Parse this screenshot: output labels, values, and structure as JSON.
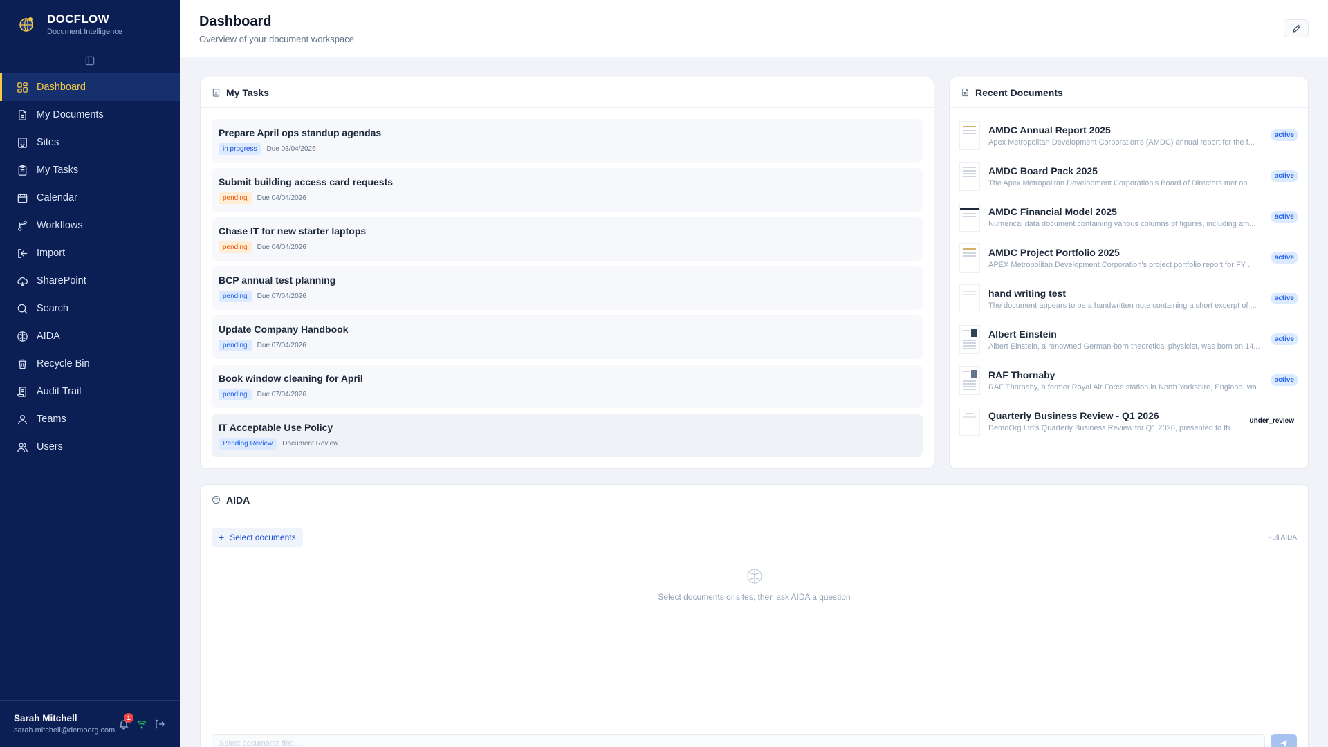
{
  "brand": {
    "name": "DOCFLOW",
    "subtitle": "Document Intelligence",
    "icon": "globe-logo-icon"
  },
  "sidebar": {
    "items": [
      {
        "label": "Dashboard",
        "icon": "grid-icon",
        "active": true
      },
      {
        "label": "My Documents",
        "icon": "document-icon"
      },
      {
        "label": "Sites",
        "icon": "building-icon"
      },
      {
        "label": "My Tasks",
        "icon": "clipboard-icon"
      },
      {
        "label": "Calendar",
        "icon": "calendar-icon"
      },
      {
        "label": "Workflows",
        "icon": "workflow-icon"
      },
      {
        "label": "Import",
        "icon": "import-icon"
      },
      {
        "label": "SharePoint",
        "icon": "cloud-icon"
      },
      {
        "label": "Search",
        "icon": "search-icon"
      },
      {
        "label": "AIDA",
        "icon": "brain-icon"
      },
      {
        "label": "Recycle Bin",
        "icon": "trash-icon"
      },
      {
        "label": "Audit Trail",
        "icon": "scroll-icon"
      },
      {
        "label": "Teams",
        "icon": "team-icon"
      },
      {
        "label": "Users",
        "icon": "users-icon"
      }
    ]
  },
  "user": {
    "name": "Sarah Mitchell",
    "email": "sarah.mitchell@demoorg.com",
    "notifications": "1"
  },
  "header": {
    "title": "Dashboard",
    "subtitle": "Overview of your document workspace"
  },
  "tasks": {
    "title": "My Tasks",
    "items": [
      {
        "title": "Prepare April ops standup agendas",
        "status": "in progress",
        "due": "Due 03/04/2026"
      },
      {
        "title": "Submit building access card requests",
        "status": "pending",
        "due": "Due 04/04/2026"
      },
      {
        "title": "Chase IT for new starter laptops",
        "status": "pending",
        "due": "Due 04/04/2026"
      },
      {
        "title": "BCP annual test planning",
        "status": "pending",
        "due": "Due 07/04/2026"
      },
      {
        "title": "Update Company Handbook",
        "status": "pending",
        "due": "Due 07/04/2026"
      },
      {
        "title": "Book window cleaning for April",
        "status": "pending",
        "due": "Due 07/04/2026"
      },
      {
        "title": "IT Acceptable Use Policy",
        "status": "Pending Review",
        "due": "Document Review"
      }
    ]
  },
  "recent": {
    "title": "Recent Documents",
    "items": [
      {
        "title": "AMDC Annual Report 2025",
        "desc": "Apex Metropolitan Development Corporation's (AMDC) annual report for the f...",
        "status": "active"
      },
      {
        "title": "AMDC Board Pack 2025",
        "desc": "The Apex Metropolitan Development Corporation's Board of Directors met on ...",
        "status": "active"
      },
      {
        "title": "AMDC Financial Model 2025",
        "desc": "Numerical data document containing various columns of figures, including am...",
        "status": "active"
      },
      {
        "title": "AMDC Project Portfolio 2025",
        "desc": "APEX Metropolitan Development Corporation's project portfolio report for FY ...",
        "status": "active"
      },
      {
        "title": "hand writing test",
        "desc": "The document appears to be a handwritten note containing a short excerpt of ...",
        "status": "active"
      },
      {
        "title": "Albert Einstein",
        "desc": "Albert Einstein, a renowned German-born theoretical physicist, was born on 14...",
        "status": "active"
      },
      {
        "title": "RAF Thornaby",
        "desc": "RAF Thornaby, a former Royal Air Force station in North Yorkshire, England, wa...",
        "status": "active"
      },
      {
        "title": "Quarterly Business Review - Q1 2026",
        "desc": "DemoOrg Ltd's Quarterly Business Review for Q1 2026, presented to th...",
        "status": "under_review"
      }
    ]
  },
  "aida": {
    "title": "AIDA",
    "select_label": "Select documents",
    "mode_label": "Full AIDA",
    "empty_text": "Select documents or sites, then ask AIDA a question",
    "input_placeholder": "Select documents first..."
  },
  "colors": {
    "sidebar_bg": "#0b1f55",
    "accent": "#f6c945",
    "active_badge": "#2563eb",
    "pending_orange": "#ea580c"
  }
}
